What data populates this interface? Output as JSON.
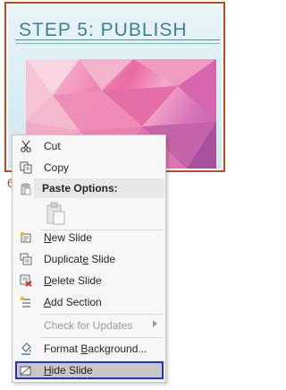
{
  "slide": {
    "title": "STEP 5: PUBLISH",
    "number": "6"
  },
  "menu": {
    "cut": "Cut",
    "copy": "Copy",
    "paste_options": "Paste Options:",
    "new_slide": "New Slide",
    "duplicate_slide": "Duplicate Slide",
    "delete_slide": "Delete Slide",
    "add_section": "Add Section",
    "check_for_updates": "Check for Updates",
    "format_background": "Format Background...",
    "hide_slide": "Hide Slide"
  },
  "colors": {
    "slide_border": "#c8471d",
    "title": "#3a7f91",
    "highlight_outline": "#1f2fe0"
  }
}
